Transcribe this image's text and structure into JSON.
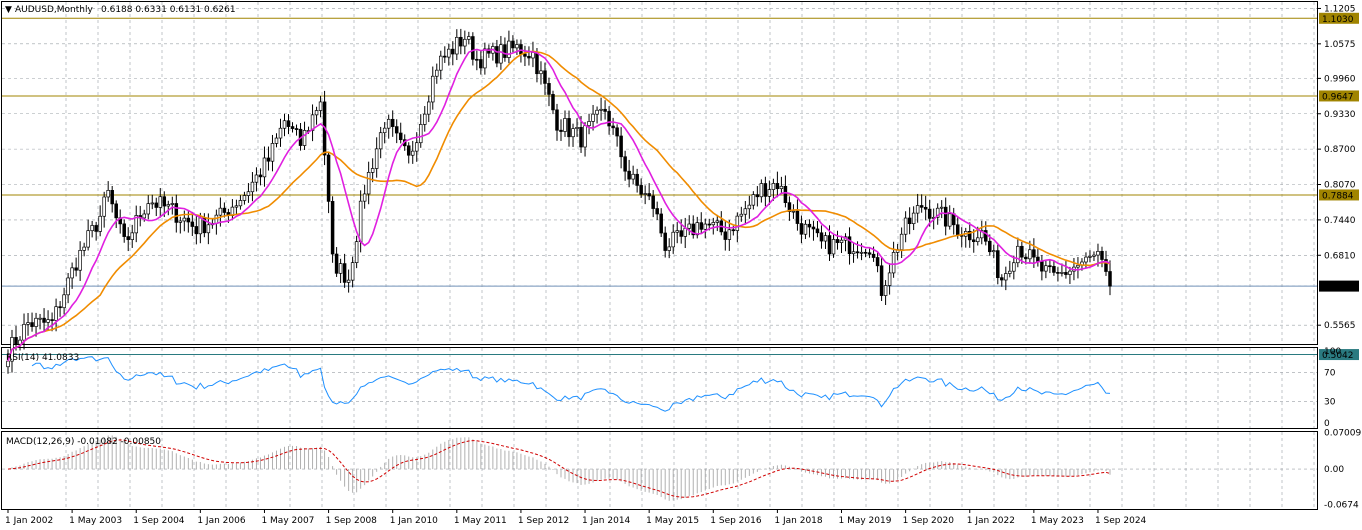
{
  "header": {
    "symbol_text": "AUDUSD,Monthly",
    "ohlc_text": "0.6188 0.6331 0.6131 0.6261"
  },
  "rsi_panel": {
    "label": "RSI(14) 41.0833"
  },
  "macd_panel": {
    "label": "MACD(12,26,9) -0.01082 -0.00850"
  },
  "colors": {
    "background": "#ffffff",
    "grid": "#9aa0a6",
    "candle": "#000000",
    "ma_fast": "#e020e0",
    "ma_slow": "#f08c00",
    "level_line": "#a08400",
    "current_line": "#7090b8",
    "bottom_line": "#2a7a80",
    "rsi_line": "#1e90ff",
    "macd_hist": "#b0b0b0",
    "macd_signal": "#d00000",
    "price_tag": "#000000",
    "level_tag": "#a08400",
    "bottom_tag": "#2a7a80"
  },
  "chart_data": [
    {
      "type": "candlestick",
      "title": "AUDUSD,Monthly",
      "ylim": [
        0.523,
        1.132
      ],
      "y_ticks": [
        "1.1205",
        "1.0575",
        "0.9960",
        "0.9330",
        "0.8700",
        "0.8070",
        "0.7440",
        "0.6810",
        "0.6261",
        "0.5565",
        "0.5042"
      ],
      "x_tick_labels": [
        "1 Jan 2002",
        "1 May 2003",
        "1 Sep 2004",
        "1 Jan 2006",
        "1 May 2007",
        "1 Sep 2008",
        "1 Jan 2010",
        "1 May 2011",
        "1 Sep 2012",
        "1 Jan 2014",
        "1 May 2015",
        "1 Sep 2016",
        "1 Jan 2018",
        "1 May 2019",
        "1 Sep 2020",
        "1 Jan 2022",
        "1 May 2023",
        "1 Sep 2024"
      ],
      "horizontal_levels": [
        {
          "value": 1.103,
          "label": "1.1030",
          "kind": "level"
        },
        {
          "value": 0.9647,
          "label": "0.9647",
          "kind": "level"
        },
        {
          "value": 0.7884,
          "label": "0.7884",
          "kind": "level"
        },
        {
          "value": 0.6261,
          "label": "0.6261",
          "kind": "current"
        },
        {
          "value": 0.5042,
          "label": "0.5042",
          "kind": "bottom"
        }
      ],
      "keypoints": [
        [
          "2002-01",
          0.51
        ],
        [
          "2002-06",
          0.56
        ],
        [
          "2002-12",
          0.56
        ],
        [
          "2003-06",
          0.67
        ],
        [
          "2003-12",
          0.75
        ],
        [
          "2004-02",
          0.79
        ],
        [
          "2004-06",
          0.7
        ],
        [
          "2004-12",
          0.78
        ],
        [
          "2005-06",
          0.76
        ],
        [
          "2005-12",
          0.73
        ],
        [
          "2006-06",
          0.75
        ],
        [
          "2006-12",
          0.79
        ],
        [
          "2007-06",
          0.85
        ],
        [
          "2007-10",
          0.92
        ],
        [
          "2008-02",
          0.88
        ],
        [
          "2008-07",
          0.96
        ],
        [
          "2008-10",
          0.67
        ],
        [
          "2009-02",
          0.64
        ],
        [
          "2009-06",
          0.8
        ],
        [
          "2009-11",
          0.92
        ],
        [
          "2010-05",
          0.85
        ],
        [
          "2010-12",
          1.02
        ],
        [
          "2011-07",
          1.07
        ],
        [
          "2011-10",
          1.03
        ],
        [
          "2012-03",
          1.04
        ],
        [
          "2012-08",
          1.05
        ],
        [
          "2012-12",
          1.04
        ],
        [
          "2013-06",
          0.92
        ],
        [
          "2013-12",
          0.89
        ],
        [
          "2014-06",
          0.94
        ],
        [
          "2014-12",
          0.82
        ],
        [
          "2015-06",
          0.77
        ],
        [
          "2015-09",
          0.7
        ],
        [
          "2016-01",
          0.71
        ],
        [
          "2016-06",
          0.74
        ],
        [
          "2016-12",
          0.72
        ],
        [
          "2017-06",
          0.77
        ],
        [
          "2017-09",
          0.8
        ],
        [
          "2018-01",
          0.81
        ],
        [
          "2018-06",
          0.74
        ],
        [
          "2018-12",
          0.7
        ],
        [
          "2019-06",
          0.7
        ],
        [
          "2019-12",
          0.7
        ],
        [
          "2020-03",
          0.62
        ],
        [
          "2020-08",
          0.72
        ],
        [
          "2021-01",
          0.77
        ],
        [
          "2021-06",
          0.75
        ],
        [
          "2021-12",
          0.72
        ],
        [
          "2022-04",
          0.72
        ],
        [
          "2022-09",
          0.64
        ],
        [
          "2023-01",
          0.7
        ],
        [
          "2023-06",
          0.66
        ],
        [
          "2023-10",
          0.64
        ],
        [
          "2024-03",
          0.66
        ],
        [
          "2024-09",
          0.68
        ],
        [
          "2024-12",
          0.62
        ]
      ],
      "last_close": 0.6261
    },
    {
      "type": "line",
      "title": "RSI(14) 41.0833",
      "ylim": [
        0,
        100
      ],
      "y_ticks": [
        "100",
        "70",
        "30",
        "0"
      ],
      "series": [
        {
          "name": "RSI(14)",
          "last": 41.0833
        }
      ]
    },
    {
      "type": "bar",
      "title": "MACD(12,26,9) -0.01082 -0.00850",
      "ylim": [
        -0.0761,
        0.0707
      ],
      "y_ticks": [
        "0.07009",
        "0.00",
        "-0.0674"
      ],
      "series": [
        {
          "name": "MACD",
          "last": -0.01082
        },
        {
          "name": "Signal",
          "last": -0.0085
        }
      ]
    }
  ]
}
